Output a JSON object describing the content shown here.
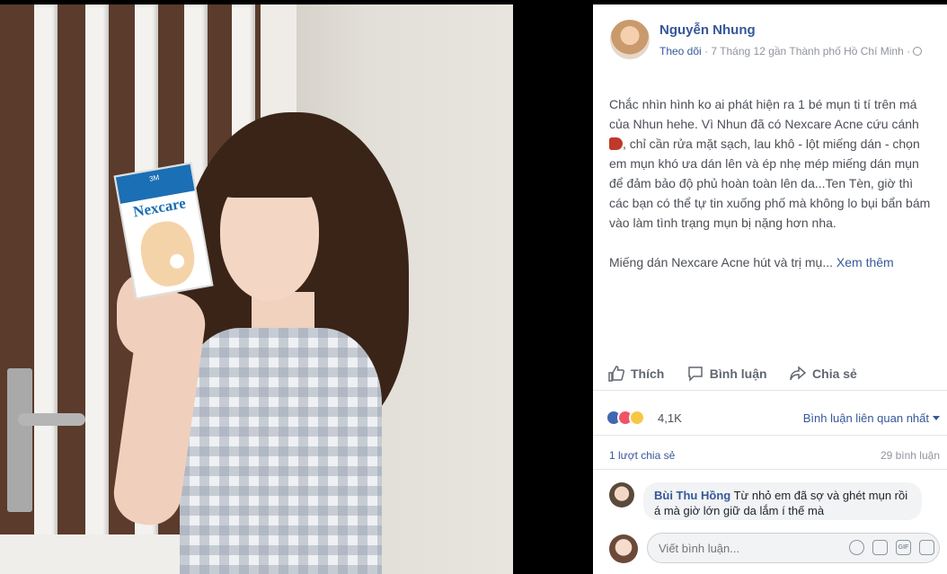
{
  "post": {
    "author": "Nguyễn Nhung",
    "follow": "Theo dõi",
    "separator": " · ",
    "date": "7 Tháng 12",
    "location_prefix": " gần ",
    "location": "Thành phố Hồ Chí Minh",
    "dot": " · ",
    "paragraph1_a": "Chắc nhìn hình ko ai phát hiện ra 1 bé mụn ti tí trên má của Nhun hehe. Vì Nhun đã có Nexcare Acne cứu cánh ",
    "paragraph1_b": ", chỉ cần rửa mặt sạch, lau khô - lột miếng dán - chọn em mụn khó ưa dán lên và ép nhẹ mép miếng dán mụn để đảm bảo độ phủ hoàn toàn lên da...Ten Tèn, giờ thì các bạn có thể tự tin xuống phố mà không lo bụi bẩn bám vào làm tình trạng mụn bị nặng hơn nha.",
    "paragraph2": "Miếng dán Nexcare Acne hút và trị mụ... ",
    "see_more": "Xem thêm"
  },
  "photo": {
    "box_brand": "Nexcare",
    "box_top": "3M"
  },
  "actions": {
    "like": "Thích",
    "comment": "Bình luận",
    "share": "Chia sẻ"
  },
  "reactions": {
    "count": "4,1K",
    "sort_label": "Bình luận liên quan nhất"
  },
  "stats": {
    "shares": "1 lượt chia sẻ",
    "comments": "29 bình luận"
  },
  "comment": {
    "name": "Bùi Thu Hồng",
    "text": " Từ nhỏ em đã sợ và ghét mụn rồi á mà giờ lớn giữ da lắm í thế mà"
  },
  "composer": {
    "placeholder": "Viết bình luận...",
    "gif_label": "GIF"
  },
  "colors": {
    "link": "#365899",
    "text": "#4b4f56",
    "muted": "#90949c"
  }
}
